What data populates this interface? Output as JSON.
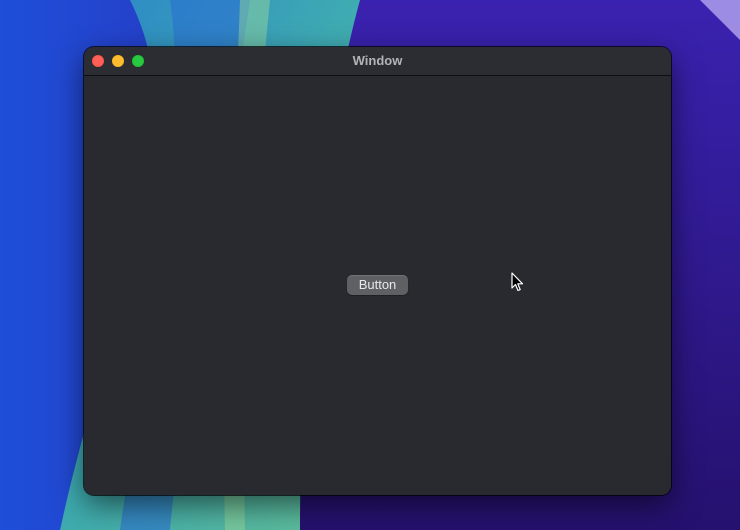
{
  "window": {
    "title": "Window",
    "traffic_lights": {
      "close": "#fe5f57",
      "minimize": "#febc2e",
      "zoom": "#28c840"
    },
    "background": "#282a30"
  },
  "content": {
    "button_label": "Button"
  },
  "pointer": {
    "icon": "arrow-cursor-icon"
  },
  "desktop": {
    "accent_colors": [
      "#1e3fd6",
      "#3b1a9a",
      "#2a0f6e",
      "#5cc7b0"
    ]
  }
}
